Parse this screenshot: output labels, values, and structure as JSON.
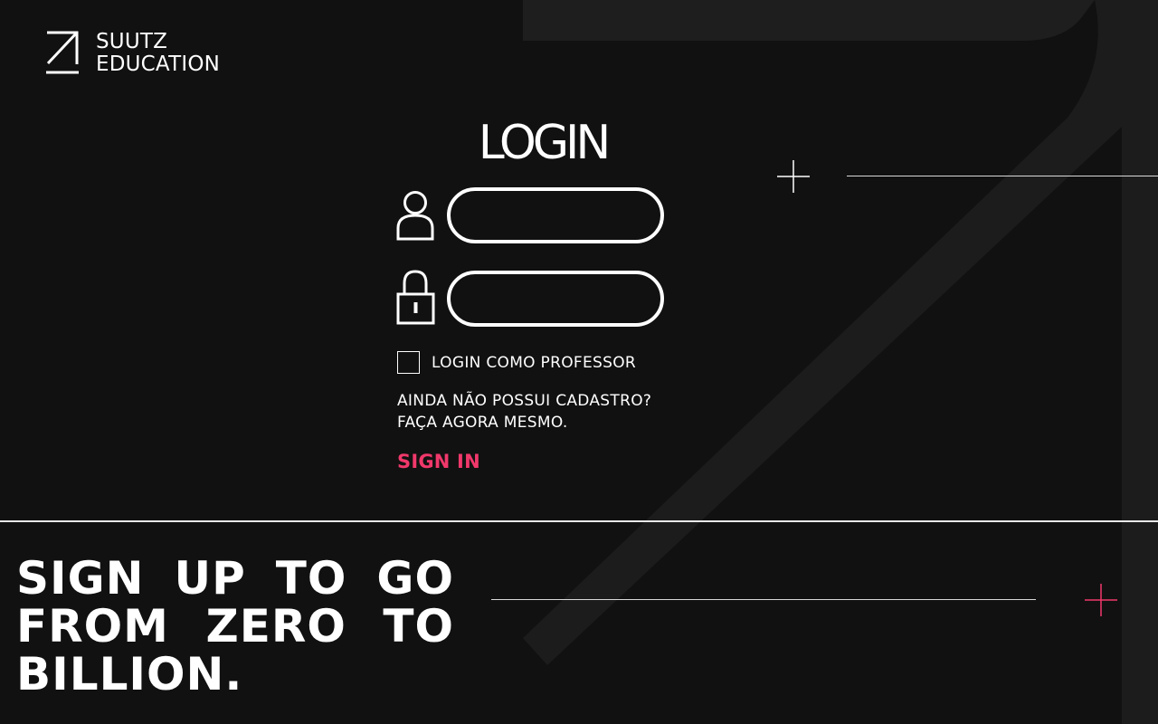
{
  "brand": {
    "line1": "SUUTZ",
    "line2": "EDUCATION"
  },
  "login": {
    "title": "LOGIN",
    "username": {
      "value": "",
      "placeholder": "",
      "icon": "user-icon"
    },
    "password": {
      "value": "",
      "placeholder": "",
      "icon": "lock-icon"
    },
    "teacher_checkbox": {
      "label": "LOGIN COMO PROFESSOR",
      "checked": false
    },
    "signup_prompt_line1": "AINDA NÃO POSSUI CADASTRO?",
    "signup_prompt_line2": "FAÇA AGORA MESMO.",
    "signin_label": "SIGN IN"
  },
  "slogan": {
    "line1_words": [
      "SIGN",
      "UP",
      "TO",
      "GO"
    ],
    "line2_words": [
      "FROM",
      "ZERO",
      "TO"
    ],
    "line3_words": [
      "BILLION."
    ]
  },
  "colors": {
    "background": "#111111",
    "accent": "#f0386b",
    "foreground": "#ffffff",
    "decor": "#1e1e1e"
  }
}
